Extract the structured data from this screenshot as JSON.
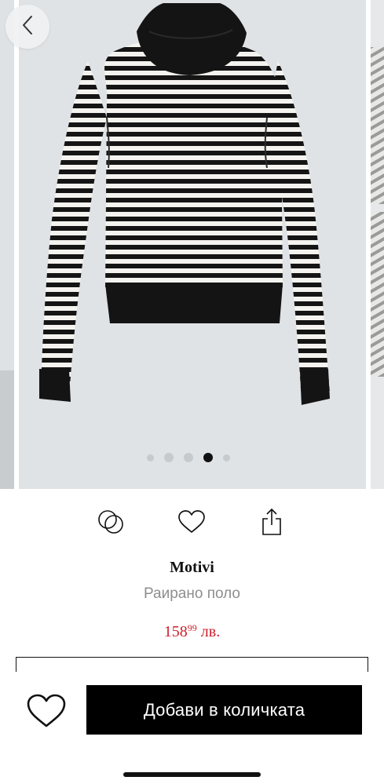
{
  "gallery": {
    "image_alt": "",
    "page_count": 5,
    "active_page": 4
  },
  "product": {
    "brand": "Motivi",
    "name": "Раирано поло",
    "price_main": "158",
    "price_cents": "99",
    "currency": "лв."
  },
  "actions": {
    "compare_icon": "overlapping-circles-icon",
    "favorite_icon": "heart-icon",
    "share_icon": "share-icon"
  },
  "bottom_bar": {
    "favorite_icon": "heart-icon",
    "add_to_cart_label": "Добави в количката"
  },
  "colors": {
    "price": "#cc1f2b",
    "button_bg": "#000000",
    "image_bg": "#dfe3e6",
    "dot_inactive": "#c7cacc",
    "dot_active": "#111111"
  }
}
